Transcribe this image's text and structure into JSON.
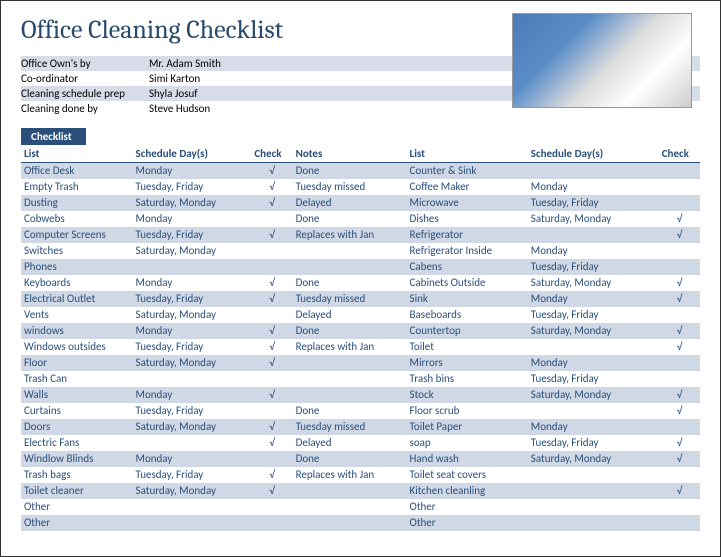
{
  "title": "Office Cleaning Checklist",
  "meta": [
    {
      "label": "Office Own's by",
      "value": "Mr. Adam Smith",
      "alt": true
    },
    {
      "label": "Co-ordinator",
      "value": "Simi Karton",
      "alt": false
    },
    {
      "label": "Cleaning schedule prep",
      "value": "Shyla Josuf",
      "alt": true
    },
    {
      "label": "Cleaning done by",
      "value": "Steve Hudson",
      "alt": false
    }
  ],
  "tag": "Checklist",
  "headers": {
    "list1": "List",
    "sched1": "Schedule Day(s)",
    "check1": "Check",
    "notes": "Notes",
    "list2": "List",
    "sched2": "Schedule Day(s)",
    "check2": "Check"
  },
  "rows": [
    {
      "alt": true,
      "l": "Office Desk",
      "s": "Monday",
      "c": "√",
      "n": "Done",
      "l2": "Counter & Sink",
      "s2": "",
      "c2": ""
    },
    {
      "alt": false,
      "l": "Empty Trash",
      "s": "Tuesday, Friday",
      "c": "√",
      "n": "Tuesday missed",
      "l2": "Coffee Maker",
      "s2": "Monday",
      "c2": ""
    },
    {
      "alt": true,
      "l": "Dusting",
      "s": "Saturday, Monday",
      "c": "√",
      "n": "Delayed",
      "l2": "Microwave",
      "s2": "Tuesday, Friday",
      "c2": ""
    },
    {
      "alt": false,
      "l": "Cobwebs",
      "s": "Monday",
      "c": "",
      "n": "Done",
      "l2": "Dishes",
      "s2": "Saturday, Monday",
      "c2": "√"
    },
    {
      "alt": true,
      "l": "Computer Screens",
      "s": "Tuesday, Friday",
      "c": "√",
      "n": "Replaces with Jan",
      "l2": "Refrigerator",
      "s2": "",
      "c2": "√"
    },
    {
      "alt": false,
      "l": "Switches",
      "s": "Saturday, Monday",
      "c": "",
      "n": "",
      "l2": "Refrigerator Inside",
      "s2": "Monday",
      "c2": ""
    },
    {
      "alt": true,
      "l": "Phones",
      "s": "",
      "c": "",
      "n": "",
      "l2": "Cabens",
      "s2": "Tuesday, Friday",
      "c2": ""
    },
    {
      "alt": false,
      "l": "Keyboards",
      "s": "Monday",
      "c": "√",
      "n": "Done",
      "l2": "Cabinets Outside",
      "s2": "Saturday, Monday",
      "c2": "√"
    },
    {
      "alt": true,
      "l": "Electrical Outlet",
      "s": "Tuesday, Friday",
      "c": "√",
      "n": "Tuesday missed",
      "l2": "Sink",
      "s2": "Monday",
      "c2": "√"
    },
    {
      "alt": false,
      "l": "Vents",
      "s": "Saturday, Monday",
      "c": "",
      "n": "Delayed",
      "l2": "Baseboards",
      "s2": "Tuesday, Friday",
      "c2": ""
    },
    {
      "alt": true,
      "l": "windows",
      "s": "Monday",
      "c": "√",
      "n": "Done",
      "l2": "Countertop",
      "s2": "Saturday, Monday",
      "c2": "√"
    },
    {
      "alt": false,
      "l": "Windows outsides",
      "s": "Tuesday, Friday",
      "c": "√",
      "n": "Replaces with Jan",
      "l2": "Toilet",
      "s2": "",
      "c2": "√"
    },
    {
      "alt": true,
      "l": "Floor",
      "s": "Saturday, Monday",
      "c": "√",
      "n": "",
      "l2": "Mirrors",
      "s2": "Monday",
      "c2": ""
    },
    {
      "alt": false,
      "l": "Trash Can",
      "s": "",
      "c": "",
      "n": "",
      "l2": "Trash bins",
      "s2": "Tuesday, Friday",
      "c2": ""
    },
    {
      "alt": true,
      "l": "Walls",
      "s": "Monday",
      "c": "√",
      "n": "",
      "l2": "Stock",
      "s2": "Saturday, Monday",
      "c2": "√"
    },
    {
      "alt": false,
      "l": "Curtains",
      "s": "Tuesday, Friday",
      "c": "",
      "n": "Done",
      "l2": "Floor scrub",
      "s2": "",
      "c2": "√"
    },
    {
      "alt": true,
      "l": "Doors",
      "s": "Saturday, Monday",
      "c": "√",
      "n": "Tuesday missed",
      "l2": "Toilet Paper",
      "s2": "Monday",
      "c2": ""
    },
    {
      "alt": false,
      "l": "Electric Fans",
      "s": "",
      "c": "√",
      "n": "Delayed",
      "l2": "soap",
      "s2": "Tuesday, Friday",
      "c2": "√"
    },
    {
      "alt": true,
      "l": "Windlow Blinds",
      "s": "Monday",
      "c": "",
      "n": "Done",
      "l2": "Hand wash",
      "s2": "Saturday, Monday",
      "c2": "√"
    },
    {
      "alt": false,
      "l": "Trash bags",
      "s": "Tuesday, Friday",
      "c": "√",
      "n": "Replaces with Jan",
      "l2": "Toilet seat covers",
      "s2": "",
      "c2": ""
    },
    {
      "alt": true,
      "l": "Toilet cleaner",
      "s": "Saturday, Monday",
      "c": "√",
      "n": "",
      "l2": "Kitchen cleanling",
      "s2": "",
      "c2": "√"
    },
    {
      "alt": false,
      "l": "Other",
      "s": "",
      "c": "",
      "n": "",
      "l2": "Other",
      "s2": "",
      "c2": ""
    },
    {
      "alt": true,
      "l": "Other",
      "s": "",
      "c": "",
      "n": "",
      "l2": "Other",
      "s2": "",
      "c2": ""
    }
  ]
}
